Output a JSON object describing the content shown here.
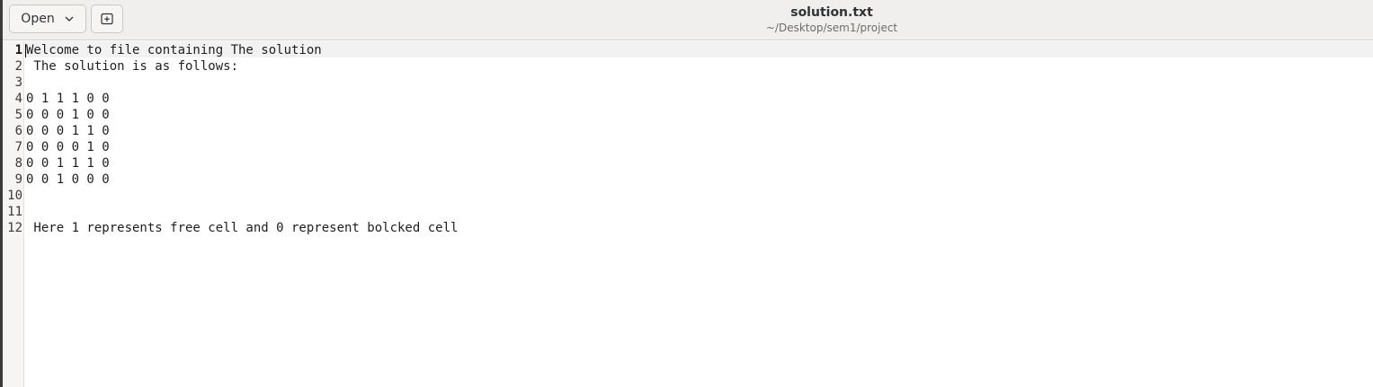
{
  "toolbar": {
    "open_label": "Open",
    "open_icon": "chevron-down-icon",
    "new_tab_icon": "new-tab-icon"
  },
  "window": {
    "title": "solution.txt",
    "subtitle": "~/Desktop/sem1/project"
  },
  "editor": {
    "current_line": 1,
    "lines": [
      {
        "number": "1",
        "text": "Welcome to file containing The solution"
      },
      {
        "number": "2",
        "text": " The solution is as follows:"
      },
      {
        "number": "3",
        "text": ""
      },
      {
        "number": "4",
        "text": "0 1 1 1 0 0"
      },
      {
        "number": "5",
        "text": "0 0 0 1 0 0"
      },
      {
        "number": "6",
        "text": "0 0 0 1 1 0"
      },
      {
        "number": "7",
        "text": "0 0 0 0 1 0"
      },
      {
        "number": "8",
        "text": "0 0 1 1 1 0"
      },
      {
        "number": "9",
        "text": "0 0 1 0 0 0"
      },
      {
        "number": "10",
        "text": ""
      },
      {
        "number": "11",
        "text": ""
      },
      {
        "number": "12",
        "text": " Here 1 represents free cell and 0 represent bolcked cell"
      }
    ]
  }
}
